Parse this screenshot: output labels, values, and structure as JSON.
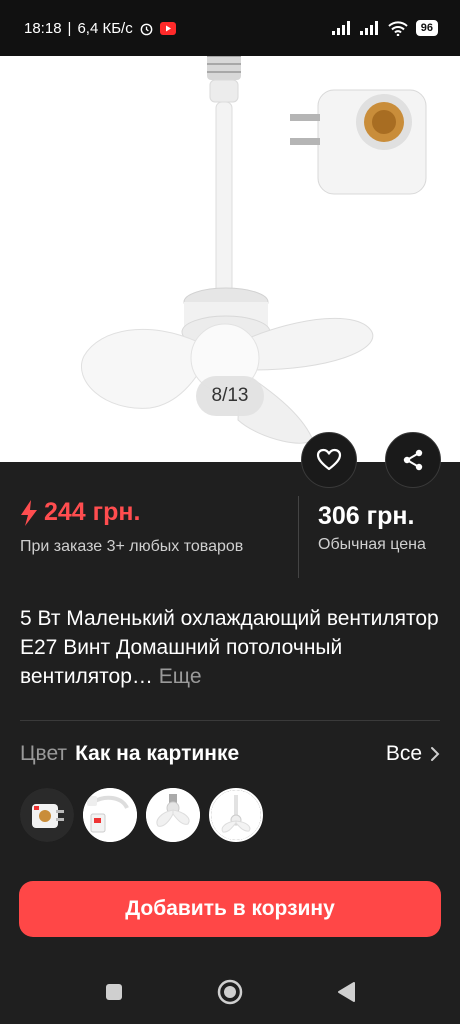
{
  "status": {
    "time": "18:18",
    "network_speed": "6,4 КБ/с",
    "battery": "96"
  },
  "gallery": {
    "counter": "8/13"
  },
  "price": {
    "promo_price": "244 грн.",
    "promo_note": "При заказе 3+ любых товаров",
    "regular_price": "306 грн.",
    "regular_note": "Обычная цена"
  },
  "product": {
    "title": "5 Вт Маленький охлаждающий вентилятор E27 Винт Домашний потолочный вентилятор…",
    "more_label": "Еще"
  },
  "color": {
    "label": "Цвет",
    "value": "Как на картинке",
    "all_label": "Все"
  },
  "actions": {
    "add_to_cart": "Добавить в корзину"
  },
  "colors": {
    "accent": "#ff4747",
    "background": "#1f1f1f"
  }
}
